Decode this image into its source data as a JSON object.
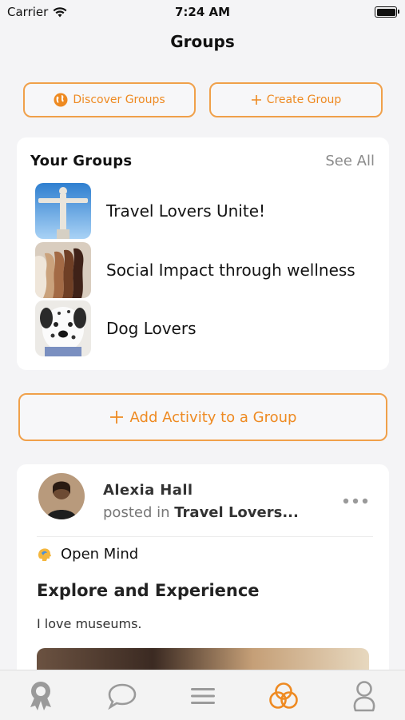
{
  "status_bar": {
    "carrier": "Carrier",
    "time": "7:24 AM"
  },
  "nav": {
    "title": "Groups"
  },
  "actions": {
    "discover_label": "Discover Groups",
    "create_label": "Create Group"
  },
  "your_groups": {
    "title": "Your Groups",
    "see_all_label": "See All",
    "items": [
      {
        "name": "Travel Lovers Unite!"
      },
      {
        "name": "Social Impact through wellness"
      },
      {
        "name": "Dog Lovers"
      }
    ]
  },
  "add_activity_label": "Add Activity to a Group",
  "post": {
    "author": "Alexia Hall",
    "posted_in_prefix": "posted in",
    "group_name": "Travel Lovers...",
    "category": "Open Mind",
    "title": "Explore and Experience",
    "body": "I love museums."
  },
  "tab_bar": {
    "active_tab": "groups",
    "accent_color": "#ee8a22",
    "inactive_color": "#9a9a9a",
    "tabs": [
      "award-icon",
      "chat-bubble-icon",
      "menu-icon",
      "groups-rings-icon",
      "profile-icon"
    ]
  }
}
